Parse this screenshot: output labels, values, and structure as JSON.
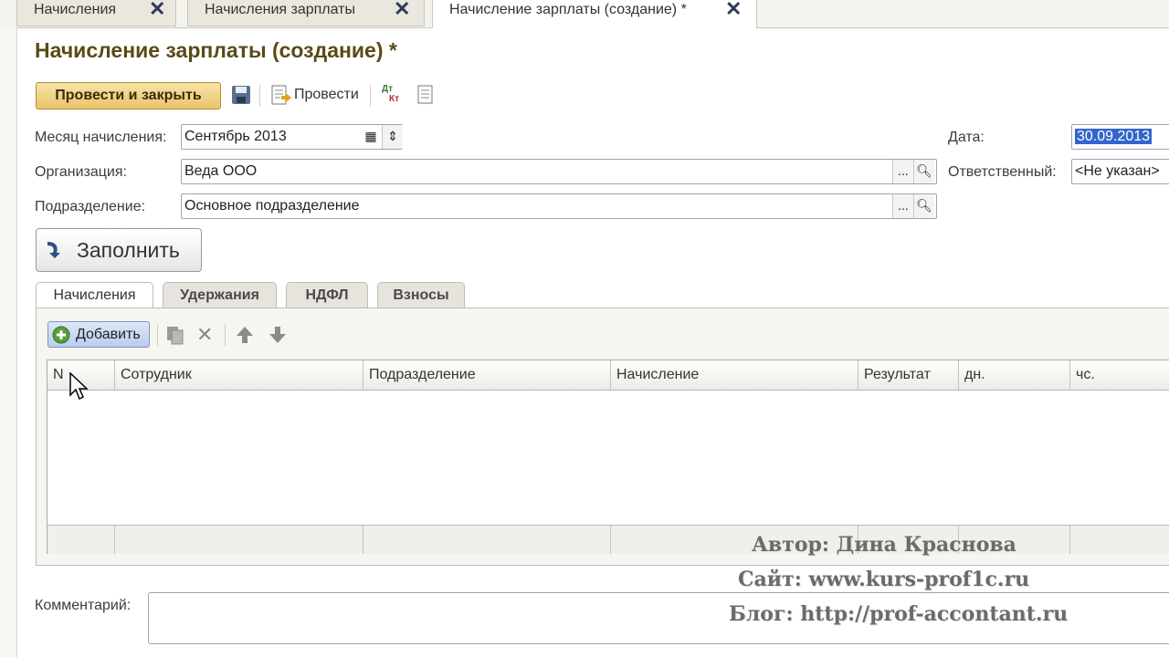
{
  "window_tabs": [
    {
      "label": "Начисления"
    },
    {
      "label": "Начисления зарплаты"
    },
    {
      "label": "Начисление зарплаты (создание) *"
    }
  ],
  "form_title": "Начисление зарплаты (создание) *",
  "toolbar": {
    "post_and_close": "Провести и закрыть",
    "post": "Провести",
    "dt_kt_top": "Дт",
    "dt_kt_bottom": "Кт"
  },
  "fields": {
    "month_label": "Месяц начисления:",
    "month_value": "Сентябрь 2013",
    "org_label": "Организация:",
    "org_value": "Веда ООО",
    "dept_label": "Подразделение:",
    "dept_value": "Основное подразделение",
    "date_label": "Дата:",
    "date_value": "30.09.2013",
    "responsible_label": "Ответственный:",
    "responsible_value": "<Не указан>",
    "ellipsis": "...",
    "comment_label": "Комментарий:"
  },
  "fill_button": "Заполнить",
  "tabs": [
    "Начисления",
    "Удержания",
    "НДФЛ",
    "Взносы"
  ],
  "table_toolbar": {
    "add": "Добавить"
  },
  "columns": [
    "N",
    "Сотрудник",
    "Подразделение",
    "Начисление",
    "Результат",
    "дн.",
    "чс."
  ],
  "watermark": {
    "author": "Автор: Дина Краснова",
    "site": "Сайт: www.kurs-prof1c.ru",
    "blog": "Блог: http://prof-accontant.ru"
  },
  "colors": {
    "accent": "#e9c46c",
    "title": "#5a4a16",
    "selection": "#3366cc"
  }
}
